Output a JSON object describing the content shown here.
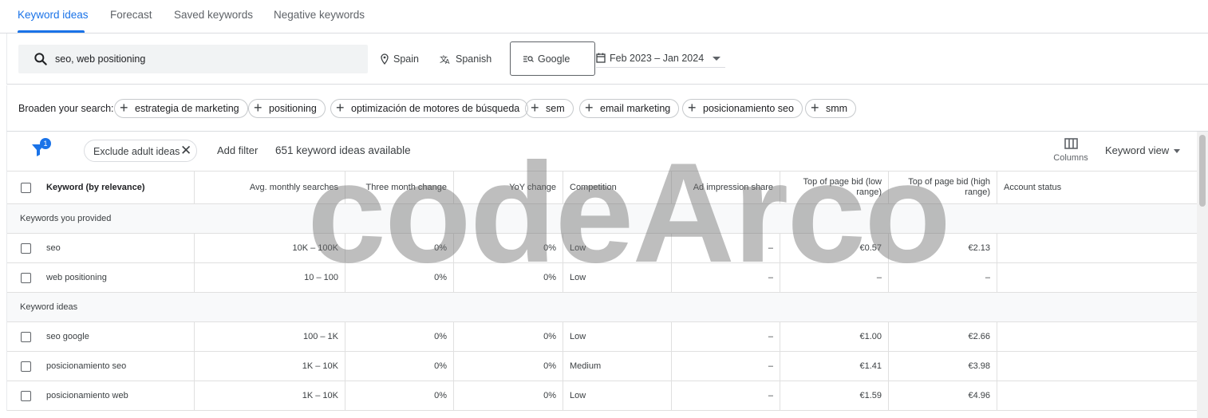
{
  "tabs": [
    {
      "label": "Keyword ideas",
      "active": true
    },
    {
      "label": "Forecast",
      "active": false
    },
    {
      "label": "Saved keywords",
      "active": false
    },
    {
      "label": "Negative keywords",
      "active": false
    }
  ],
  "search": {
    "query": "seo, web positioning",
    "location": "Spain",
    "language": "Spanish",
    "engine": "Google",
    "date_range": "Feb 2023 – Jan 2024"
  },
  "broaden": {
    "label": "Broaden your search:",
    "chips": [
      "estrategia de marketing",
      "positioning",
      "optimización de motores de búsqueda",
      "sem",
      "email marketing",
      "posicionamiento seo",
      "smm"
    ]
  },
  "filterbar": {
    "filter_count": "1",
    "exclude_chip": "Exclude adult ideas",
    "add_filter": "Add filter",
    "available": "651 keyword ideas available",
    "columns_label": "Columns",
    "view_label": "Keyword view"
  },
  "table": {
    "headers": [
      "Keyword (by relevance)",
      "Avg. monthly searches",
      "Three month change",
      "YoY change",
      "Competition",
      "Ad impression share",
      "Top of page bid (low range)",
      "Top of page bid (high range)",
      "Account status"
    ],
    "groups": [
      {
        "label": "Keywords you provided",
        "rows": [
          [
            "seo",
            "10K – 100K",
            "0%",
            "0%",
            "Low",
            "–",
            "€0.57",
            "€2.13",
            ""
          ],
          [
            "web positioning",
            "10 – 100",
            "0%",
            "0%",
            "Low",
            "–",
            "–",
            "–",
            ""
          ]
        ]
      },
      {
        "label": "Keyword ideas",
        "rows": [
          [
            "seo google",
            "100 – 1K",
            "0%",
            "0%",
            "Low",
            "–",
            "€1.00",
            "€2.66",
            ""
          ],
          [
            "posicionamiento seo",
            "1K – 10K",
            "0%",
            "0%",
            "Medium",
            "–",
            "€1.41",
            "€3.98",
            ""
          ],
          [
            "posicionamiento web",
            "1K – 10K",
            "0%",
            "0%",
            "Low",
            "–",
            "€1.59",
            "€4.96",
            ""
          ]
        ]
      }
    ]
  },
  "watermark": "codeArco",
  "colors": {
    "accent": "#1a73e8",
    "border": "#dadce0",
    "text": "#3c4043"
  }
}
